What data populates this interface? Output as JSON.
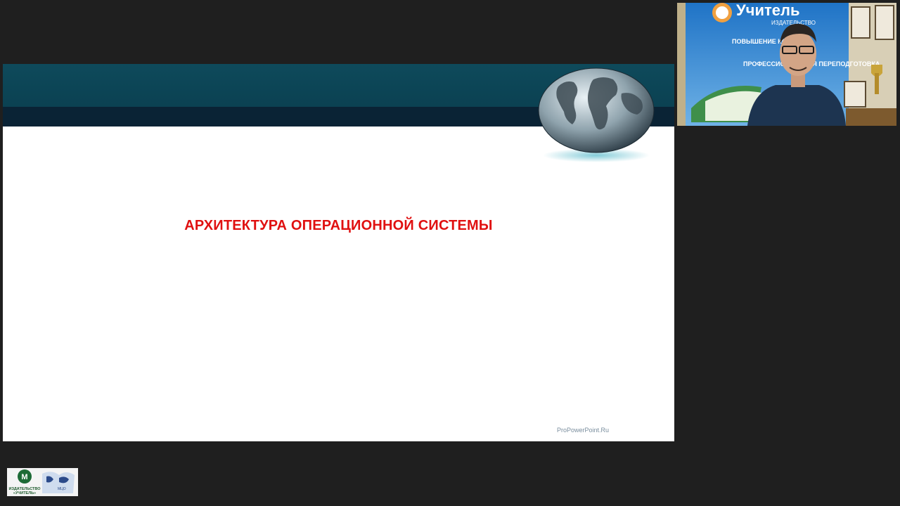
{
  "slide": {
    "title": "АРХИТЕКТУРА ОПЕРАЦИОННОЙ СИСТЕМЫ",
    "watermark": "ProPowerPoint.Ru"
  },
  "webcam": {
    "banner_brand": "Учитель",
    "banner_sub": "ИЗДАТЕЛЬСТВО",
    "banner_line1": "ПОВЫШЕНИЕ КВАЛИ...",
    "banner_line2": "ПРОФЕССИОНАЛЬНАЯ ПЕРЕПОДГОТОВКА"
  },
  "logo": {
    "publisher_line1": "ИЗДАТЕЛЬСТВО",
    "publisher_line2": "«УЧИТЕЛЬ»",
    "partner": "МЦО"
  },
  "colors": {
    "background": "#1f1f1f",
    "slide_band_teal": "#0e4a5b",
    "slide_band_dark": "#0a2335",
    "title_red": "#e01010",
    "banner_blue": "#1e6fc2"
  }
}
